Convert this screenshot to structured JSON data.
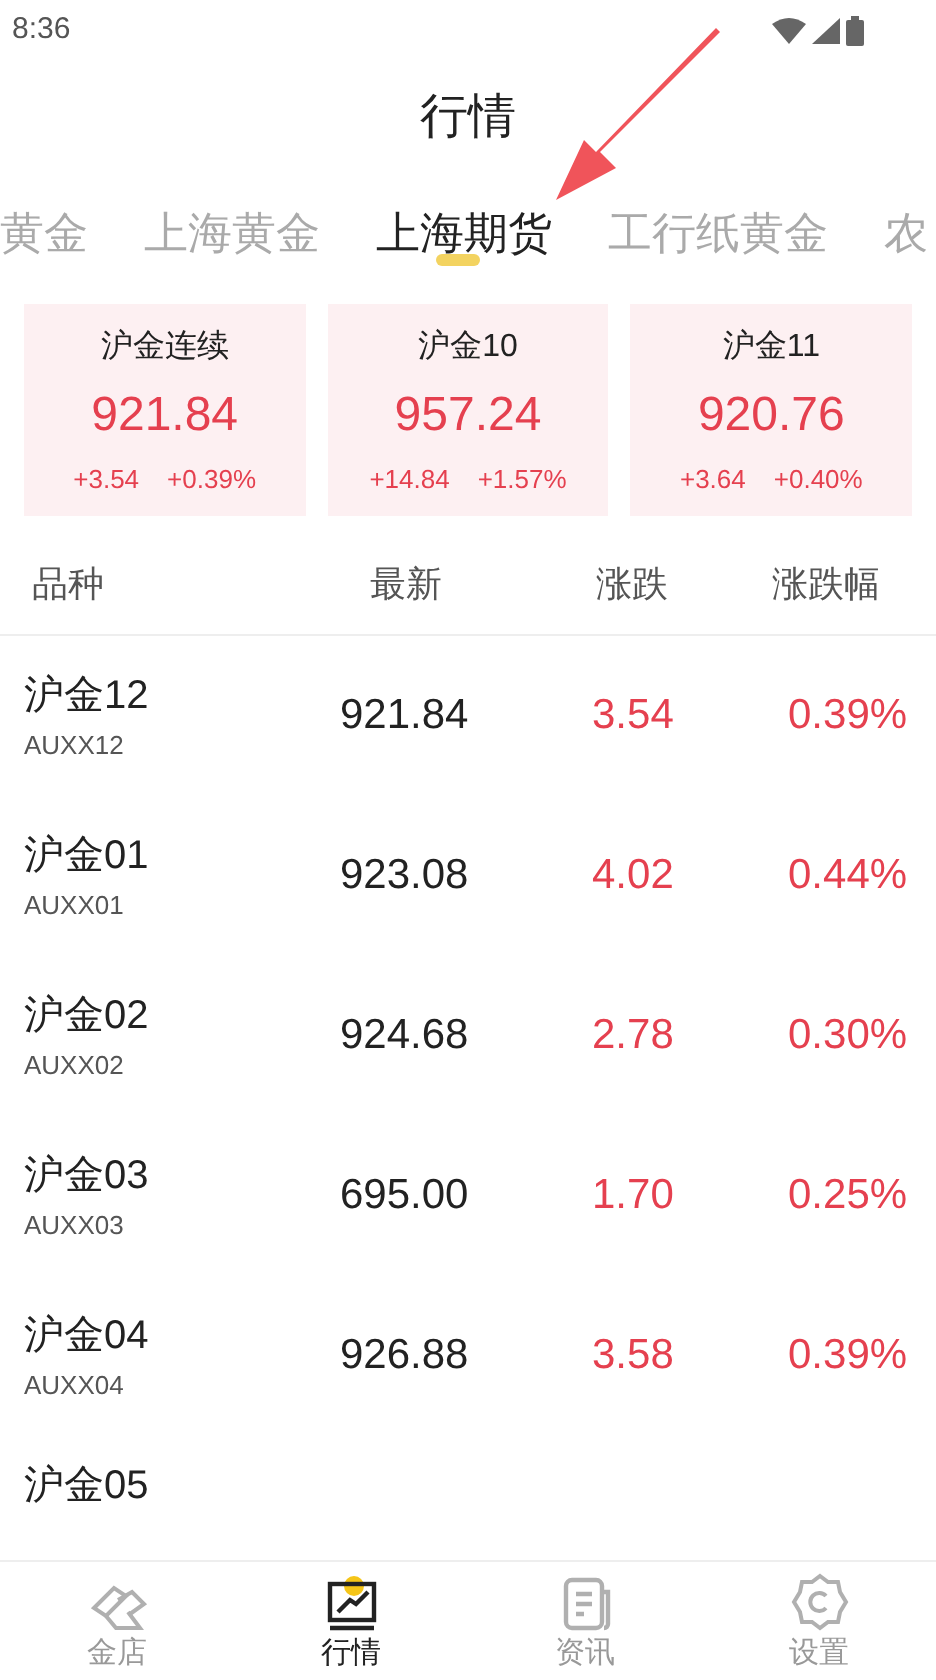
{
  "status_bar": {
    "time": "8:36"
  },
  "title": "行情",
  "tabs": [
    {
      "label": "黄金",
      "selected": false
    },
    {
      "label": "上海黄金",
      "selected": false
    },
    {
      "label": "上海期货",
      "selected": true
    },
    {
      "label": "工行纸黄金",
      "selected": false
    },
    {
      "label": "农",
      "selected": false
    }
  ],
  "cards": [
    {
      "name": "沪金连续",
      "price": "921.84",
      "change": "+3.54",
      "percent": "+0.39%"
    },
    {
      "name": "沪金10",
      "price": "957.24",
      "change": "+14.84",
      "percent": "+1.57%"
    },
    {
      "name": "沪金11",
      "price": "920.76",
      "change": "+3.64",
      "percent": "+0.40%"
    }
  ],
  "table": {
    "columns": [
      "品种",
      "最新",
      "涨跌",
      "涨跌幅"
    ],
    "rows": [
      {
        "name": "沪金12",
        "code": "AUXX12",
        "latest": "921.84",
        "change": "3.54",
        "percent": "0.39%"
      },
      {
        "name": "沪金01",
        "code": "AUXX01",
        "latest": "923.08",
        "change": "4.02",
        "percent": "0.44%"
      },
      {
        "name": "沪金02",
        "code": "AUXX02",
        "latest": "924.68",
        "change": "2.78",
        "percent": "0.30%"
      },
      {
        "name": "沪金03",
        "code": "AUXX03",
        "latest": "695.00",
        "change": "1.70",
        "percent": "0.25%"
      },
      {
        "name": "沪金04",
        "code": "AUXX04",
        "latest": "926.88",
        "change": "3.58",
        "percent": "0.39%"
      },
      {
        "name": "沪金05"
      }
    ]
  },
  "nav": [
    {
      "label": "金店",
      "kind": "bars",
      "selected": false
    },
    {
      "label": "行情",
      "kind": "chart",
      "selected": true
    },
    {
      "label": "资讯",
      "kind": "news",
      "selected": false
    },
    {
      "label": "设置",
      "kind": "gear",
      "selected": false
    }
  ]
}
